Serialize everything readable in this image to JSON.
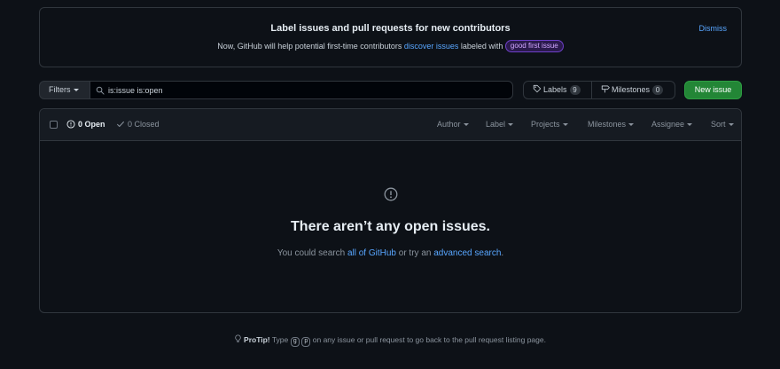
{
  "banner": {
    "title": "Label issues and pull requests for new contributors",
    "text_before": "Now, GitHub will help potential first-time contributors ",
    "link": "discover issues",
    "text_after": " labeled with ",
    "label": "good first issue",
    "dismiss": "Dismiss"
  },
  "toolbar": {
    "filters": "Filters",
    "search_value": "is:issue is:open",
    "labels": "Labels",
    "labels_count": "9",
    "milestones": "Milestones",
    "milestones_count": "0",
    "new_issue": "New issue"
  },
  "list_header": {
    "open": "0 Open",
    "closed": "0 Closed",
    "filters": {
      "author": "Author",
      "label": "Label",
      "projects": "Projects",
      "milestones": "Milestones",
      "assignee": "Assignee",
      "sort": "Sort"
    }
  },
  "blankslate": {
    "title": "There aren’t any open issues.",
    "text_before": "You could search ",
    "link_all": "all of GitHub",
    "text_middle": " or try an ",
    "link_advanced": "advanced search",
    "text_after": "."
  },
  "protip": {
    "label": "ProTip!",
    "text_before": " Type ",
    "key_g": "g",
    "key_p": "p",
    "text_after": " on any issue or pull request to go back to the pull request listing page."
  },
  "colors": {
    "background": "#0d1117",
    "border": "#30363d",
    "link": "#58a6ff",
    "primary_button": "#238636",
    "label_purple": "#d2a8ff"
  },
  "icons": [
    "search-icon",
    "tag-icon",
    "milestone-icon",
    "issue-opened-icon",
    "check-icon",
    "info-icon",
    "light-bulb-icon",
    "caret-down-icon"
  ]
}
